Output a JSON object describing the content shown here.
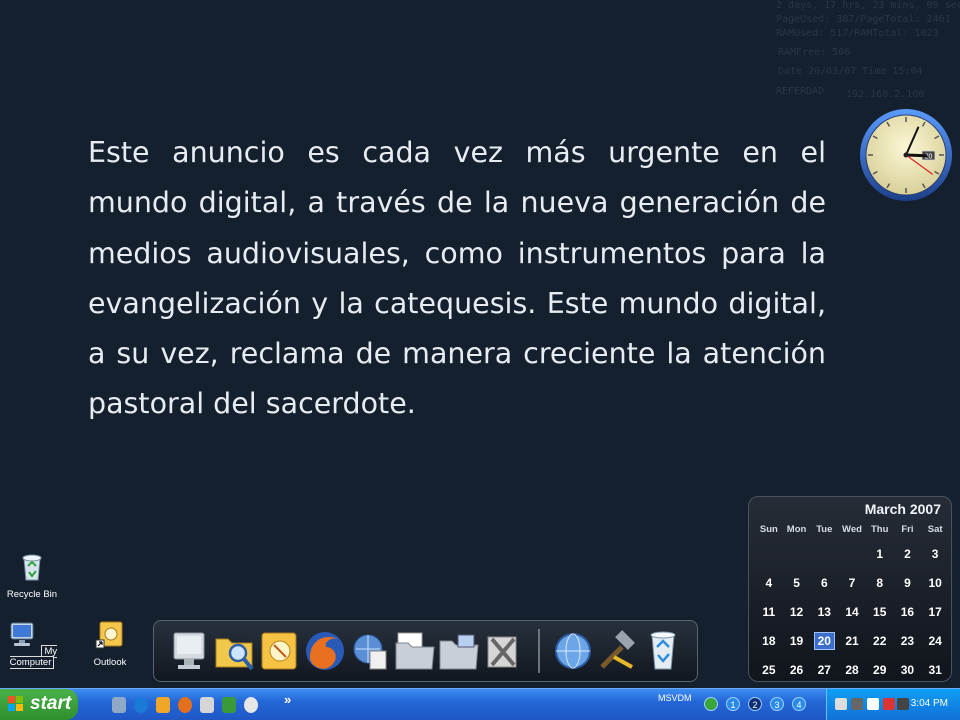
{
  "sysinfo": {
    "uptime": "2 days, 17 hrs, 23 mins, 09 secs",
    "page": "PageUsed: 387/PageTotal: 2461",
    "ram": "RAMUsed: 517/RAMTotal: 1023",
    "ramfree": "RAMFree: 506",
    "datetime": "Date 20/03/07 Time 15:04",
    "host": "REFERDAD",
    "ip": "192.168.2.100"
  },
  "clock_widget": {
    "hour": 3,
    "minute": 4,
    "second": 21,
    "date_badge": "20"
  },
  "main": {
    "paragraph": "Este anuncio es cada vez más urgente en el mundo digital, a través de la nueva generación de medios audiovisuales, como instrumentos para la evangelización y la catequesis. Este mundo digital, a su vez, reclama de manera creciente la atención pastoral del sacerdote."
  },
  "calendar": {
    "title": "March 2007",
    "weekdays": [
      "Sun",
      "Mon",
      "Tue",
      "Wed",
      "Thu",
      "Fri",
      "Sat"
    ],
    "leading_blanks": 4,
    "days": [
      1,
      2,
      3,
      4,
      5,
      6,
      7,
      8,
      9,
      10,
      11,
      12,
      13,
      14,
      15,
      16,
      17,
      18,
      19,
      20,
      21,
      22,
      23,
      24,
      25,
      26,
      27,
      28,
      29,
      30,
      31
    ],
    "today": 20
  },
  "desktop": {
    "recycle_bin": "Recycle Bin",
    "my_computer": "My Computer",
    "outlook": "Outlook"
  },
  "dock_items": [
    "monitor-icon",
    "folder-search-icon",
    "outlook-icon",
    "firefox-icon",
    "globe-doc-icon",
    "folder-icon",
    "folder-icon",
    "tools-icon",
    "network-globe-icon",
    "hammer-icon",
    "recycle-bin-icon"
  ],
  "taskbar": {
    "start_label": "start",
    "chevron": "»",
    "vdm_label": "MSVDM",
    "desktops": [
      "1",
      "2",
      "3",
      "4"
    ],
    "active_desktop": "2",
    "time": "3:04 PM"
  },
  "colors": {
    "desktop_bg": "#15202f",
    "taskbar_blue": "#2467d8",
    "start_green": "#3a9f3a",
    "today_highlight": "#3a6ec8"
  }
}
